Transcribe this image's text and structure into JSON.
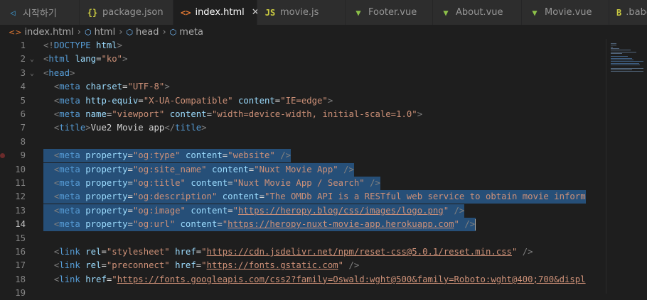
{
  "tabs": [
    {
      "label": "시작하기",
      "icon": "vscode-icon",
      "color": "#3e9cd6",
      "active": false
    },
    {
      "label": "package.json",
      "icon": "json-braces-icon",
      "color": "#cbcb41",
      "active": false
    },
    {
      "label": "index.html",
      "icon": "html-brackets-icon",
      "color": "#e37933",
      "active": true,
      "close": "✕"
    },
    {
      "label": "movie.js",
      "icon": "js-icon",
      "color": "#cbcb41",
      "active": false
    },
    {
      "label": "Footer.vue",
      "icon": "vue-icon",
      "color": "#8dc149",
      "active": false
    },
    {
      "label": "About.vue",
      "icon": "vue-icon",
      "color": "#8dc149",
      "active": false
    },
    {
      "label": "Movie.vue",
      "icon": "vue-icon",
      "color": "#8dc149",
      "active": false
    },
    {
      "label": ".babe",
      "icon": "babel-icon",
      "color": "#cbcb41",
      "active": false
    }
  ],
  "breadcrumb": [
    "index.html",
    "html",
    "head",
    "meta"
  ],
  "lines": [
    {
      "n": "1",
      "fold": "",
      "tokens": [
        [
          "p",
          "<!"
        ],
        [
          "t",
          "DOCTYPE"
        ],
        [
          "x",
          " "
        ],
        [
          "a",
          "html"
        ],
        [
          "p",
          ">"
        ]
      ]
    },
    {
      "n": "2",
      "fold": "⌄",
      "tokens": [
        [
          "p",
          "<"
        ],
        [
          "t",
          "html"
        ],
        [
          "x",
          " "
        ],
        [
          "a",
          "lang"
        ],
        [
          "x",
          "="
        ],
        [
          "s",
          "\"ko\""
        ],
        [
          "p",
          ">"
        ]
      ]
    },
    {
      "n": "3",
      "fold": "⌄",
      "tokens": [
        [
          "p",
          "<"
        ],
        [
          "t",
          "head"
        ],
        [
          "p",
          ">"
        ]
      ]
    },
    {
      "n": "4",
      "fold": "",
      "tokens": [
        [
          "x",
          "  "
        ],
        [
          "p",
          "<"
        ],
        [
          "t",
          "meta"
        ],
        [
          "x",
          " "
        ],
        [
          "a",
          "charset"
        ],
        [
          "x",
          "="
        ],
        [
          "s",
          "\"UTF-8\""
        ],
        [
          "p",
          ">"
        ]
      ]
    },
    {
      "n": "5",
      "fold": "",
      "tokens": [
        [
          "x",
          "  "
        ],
        [
          "p",
          "<"
        ],
        [
          "t",
          "meta"
        ],
        [
          "x",
          " "
        ],
        [
          "a",
          "http-equiv"
        ],
        [
          "x",
          "="
        ],
        [
          "s",
          "\"X-UA-Compatible\""
        ],
        [
          "x",
          " "
        ],
        [
          "a",
          "content"
        ],
        [
          "x",
          "="
        ],
        [
          "s",
          "\"IE=edge\""
        ],
        [
          "p",
          ">"
        ]
      ]
    },
    {
      "n": "6",
      "fold": "",
      "tokens": [
        [
          "x",
          "  "
        ],
        [
          "p",
          "<"
        ],
        [
          "t",
          "meta"
        ],
        [
          "x",
          " "
        ],
        [
          "a",
          "name"
        ],
        [
          "x",
          "="
        ],
        [
          "s",
          "\"viewport\""
        ],
        [
          "x",
          " "
        ],
        [
          "a",
          "content"
        ],
        [
          "x",
          "="
        ],
        [
          "s",
          "\"width=device-width, initial-scale=1.0\""
        ],
        [
          "p",
          ">"
        ]
      ]
    },
    {
      "n": "7",
      "fold": "",
      "tokens": [
        [
          "x",
          "  "
        ],
        [
          "p",
          "<"
        ],
        [
          "t",
          "title"
        ],
        [
          "p",
          ">"
        ],
        [
          "x",
          "Vue2 Movie app"
        ],
        [
          "p",
          "</"
        ],
        [
          "t",
          "title"
        ],
        [
          "p",
          ">"
        ]
      ]
    },
    {
      "n": "8",
      "fold": "",
      "tokens": []
    },
    {
      "n": "9",
      "fold": "",
      "sel": true,
      "dot": true,
      "tokens": [
        [
          "x",
          "  "
        ],
        [
          "p",
          "<"
        ],
        [
          "t",
          "meta"
        ],
        [
          "x",
          " "
        ],
        [
          "a",
          "property"
        ],
        [
          "x",
          "="
        ],
        [
          "s",
          "\"og:type\""
        ],
        [
          "x",
          " "
        ],
        [
          "a",
          "content"
        ],
        [
          "x",
          "="
        ],
        [
          "s",
          "\"website\""
        ],
        [
          "x",
          " "
        ],
        [
          "p",
          "/>"
        ]
      ]
    },
    {
      "n": "10",
      "fold": "",
      "sel": true,
      "tokens": [
        [
          "x",
          "  "
        ],
        [
          "p",
          "<"
        ],
        [
          "t",
          "meta"
        ],
        [
          "x",
          " "
        ],
        [
          "a",
          "property"
        ],
        [
          "x",
          "="
        ],
        [
          "s",
          "\"og:site_name\""
        ],
        [
          "x",
          " "
        ],
        [
          "a",
          "content"
        ],
        [
          "x",
          "="
        ],
        [
          "s",
          "\"Nuxt Movie App\""
        ],
        [
          "x",
          " "
        ],
        [
          "p",
          "/>"
        ]
      ]
    },
    {
      "n": "11",
      "fold": "",
      "sel": true,
      "tokens": [
        [
          "x",
          "  "
        ],
        [
          "p",
          "<"
        ],
        [
          "t",
          "meta"
        ],
        [
          "x",
          " "
        ],
        [
          "a",
          "property"
        ],
        [
          "x",
          "="
        ],
        [
          "s",
          "\"og:title\""
        ],
        [
          "x",
          " "
        ],
        [
          "a",
          "content"
        ],
        [
          "x",
          "="
        ],
        [
          "s",
          "\"Nuxt Movie App / Search\""
        ],
        [
          "x",
          " "
        ],
        [
          "p",
          "/>"
        ]
      ]
    },
    {
      "n": "12",
      "fold": "",
      "sel": true,
      "tokens": [
        [
          "x",
          "  "
        ],
        [
          "p",
          "<"
        ],
        [
          "t",
          "meta"
        ],
        [
          "x",
          " "
        ],
        [
          "a",
          "property"
        ],
        [
          "x",
          "="
        ],
        [
          "s",
          "\"og:description\""
        ],
        [
          "x",
          " "
        ],
        [
          "a",
          "content"
        ],
        [
          "x",
          "="
        ],
        [
          "s",
          "\"The OMDb API is a RESTful web service to obtain movie inform"
        ]
      ]
    },
    {
      "n": "13",
      "fold": "",
      "sel": true,
      "tokens": [
        [
          "x",
          "  "
        ],
        [
          "p",
          "<"
        ],
        [
          "t",
          "meta"
        ],
        [
          "x",
          " "
        ],
        [
          "a",
          "property"
        ],
        [
          "x",
          "="
        ],
        [
          "s",
          "\"og:image\""
        ],
        [
          "x",
          " "
        ],
        [
          "a",
          "content"
        ],
        [
          "x",
          "="
        ],
        [
          "s",
          "\""
        ],
        [
          "l",
          "https://heropy.blog/css/images/logo.png"
        ],
        [
          "s",
          "\""
        ],
        [
          "x",
          " "
        ],
        [
          "p",
          "/>"
        ]
      ]
    },
    {
      "n": "14",
      "fold": "",
      "sel": true,
      "cur": true,
      "tokens": [
        [
          "x",
          "  "
        ],
        [
          "p",
          "<"
        ],
        [
          "t",
          "meta"
        ],
        [
          "x",
          " "
        ],
        [
          "a",
          "property"
        ],
        [
          "x",
          "="
        ],
        [
          "s",
          "\"og:url\""
        ],
        [
          "x",
          " "
        ],
        [
          "a",
          "content"
        ],
        [
          "x",
          "="
        ],
        [
          "s",
          "\""
        ],
        [
          "l",
          "https://heropy-nuxt-movie-app.herokuapp.com"
        ],
        [
          "s",
          "\""
        ],
        [
          "x",
          " "
        ],
        [
          "p",
          "/>"
        ]
      ]
    },
    {
      "n": "15",
      "fold": "",
      "tokens": []
    },
    {
      "n": "16",
      "fold": "",
      "tokens": [
        [
          "x",
          "  "
        ],
        [
          "p",
          "<"
        ],
        [
          "t",
          "link"
        ],
        [
          "x",
          " "
        ],
        [
          "a",
          "rel"
        ],
        [
          "x",
          "="
        ],
        [
          "s",
          "\"stylesheet\""
        ],
        [
          "x",
          " "
        ],
        [
          "a",
          "href"
        ],
        [
          "x",
          "="
        ],
        [
          "s",
          "\""
        ],
        [
          "l",
          "https://cdn.jsdelivr.net/npm/reset-css@5.0.1/reset.min.css"
        ],
        [
          "s",
          "\""
        ],
        [
          "x",
          " "
        ],
        [
          "p",
          "/>"
        ]
      ]
    },
    {
      "n": "17",
      "fold": "",
      "tokens": [
        [
          "x",
          "  "
        ],
        [
          "p",
          "<"
        ],
        [
          "t",
          "link"
        ],
        [
          "x",
          " "
        ],
        [
          "a",
          "rel"
        ],
        [
          "x",
          "="
        ],
        [
          "s",
          "\"preconnect\""
        ],
        [
          "x",
          " "
        ],
        [
          "a",
          "href"
        ],
        [
          "x",
          "="
        ],
        [
          "s",
          "\""
        ],
        [
          "l",
          "https://fonts.gstatic.com"
        ],
        [
          "s",
          "\""
        ],
        [
          "x",
          " "
        ],
        [
          "p",
          "/>"
        ]
      ]
    },
    {
      "n": "18",
      "fold": "",
      "tokens": [
        [
          "x",
          "  "
        ],
        [
          "p",
          "<"
        ],
        [
          "t",
          "link"
        ],
        [
          "x",
          " "
        ],
        [
          "a",
          "href"
        ],
        [
          "x",
          "="
        ],
        [
          "s",
          "\""
        ],
        [
          "l",
          "https://fonts.googleapis.com/css2?family=Oswald:wght@500&family=Roboto:wght@400;700&displ"
        ]
      ]
    },
    {
      "n": "19",
      "fold": "",
      "tokens": []
    }
  ]
}
